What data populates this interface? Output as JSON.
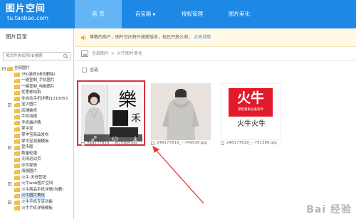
{
  "header": {
    "logo_title": "图片空间",
    "logo_domain": "tu.taobao.com",
    "nav": [
      {
        "label": "首 页",
        "active": true
      },
      {
        "label": "百宝箱",
        "active": false,
        "has_caret": true
      },
      {
        "label": "授权管理",
        "active": false
      },
      {
        "label": "图片美化",
        "active": false
      }
    ]
  },
  "sidebar": {
    "title": "图片目录",
    "search_placeholder": "按文件夹名称/ID搜索",
    "tree": [
      {
        "label": "全部图片",
        "level": 0,
        "expander": "−"
      },
      {
        "label": "350装修(请勿删除)",
        "level": 1
      },
      {
        "label": "一键宣制_手机图片",
        "level": 1
      },
      {
        "label": "一键宣制_电脑图片",
        "level": 1
      },
      {
        "label": "优惠券拍拍",
        "level": 1
      },
      {
        "label": "全自动手机详情[1210053",
        "level": 1
      },
      {
        "label": "宝贝图片",
        "level": 1,
        "expander": "+"
      },
      {
        "label": "店铺装修",
        "level": 1
      },
      {
        "label": "手机海报",
        "level": 1
      },
      {
        "label": "手机端详情",
        "level": 1
      },
      {
        "label": "掌中宝",
        "level": 1
      },
      {
        "label": "掌中宝商品发布",
        "level": 1
      },
      {
        "label": "掌中宝海报模板",
        "level": 1
      },
      {
        "label": "宣传版",
        "level": 1,
        "expander": "+"
      },
      {
        "label": "数量轮播",
        "level": 1
      },
      {
        "label": "无线运动页",
        "level": 1
      },
      {
        "label": "亦印家情",
        "level": 1
      },
      {
        "label": "海报图片",
        "level": 1
      },
      {
        "label": "火牛-无线营销",
        "level": 1
      },
      {
        "label": "火牛web图片空间",
        "level": 1,
        "expander": "+"
      },
      {
        "label": "火牛商品手机详情(勿删)",
        "level": 1
      },
      {
        "label": "火牛图片美化",
        "level": 1,
        "selected": true
      },
      {
        "label": "火牛手机专享功能",
        "level": 1,
        "expander": "+"
      },
      {
        "label": "火牛手机详情模板",
        "level": 1
      }
    ]
  },
  "notice": {
    "text": "尊敬的商户，图片空间将升级新版本，现已开放公测，",
    "link": "点击试用"
  },
  "breadcrumb": {
    "items": [
      "全部图片",
      "火牛图片美化"
    ],
    "separator": ">"
  },
  "select_all_label": "全选",
  "cards": [
    {
      "caption": "248177819_···607988.jpg",
      "selected": true,
      "calligraphy_top": "樂",
      "calligraphy_side": "禾"
    },
    {
      "caption": "248177819_···749916.jpg",
      "selected": false
    },
    {
      "caption": "248177819_···791386.jpg",
      "selected": false,
      "logo_text": "火牛",
      "logo_sub": "掌柜看家必备软件",
      "logo_caption": "火牛火牛"
    }
  ],
  "watermark": "Bai 经验",
  "colors": {
    "header_bg": "#1e88e5",
    "nav_active": "#64b5f6",
    "selection_border": "#d9313a",
    "arrow": "#e53935",
    "link": "#1e88e5"
  }
}
